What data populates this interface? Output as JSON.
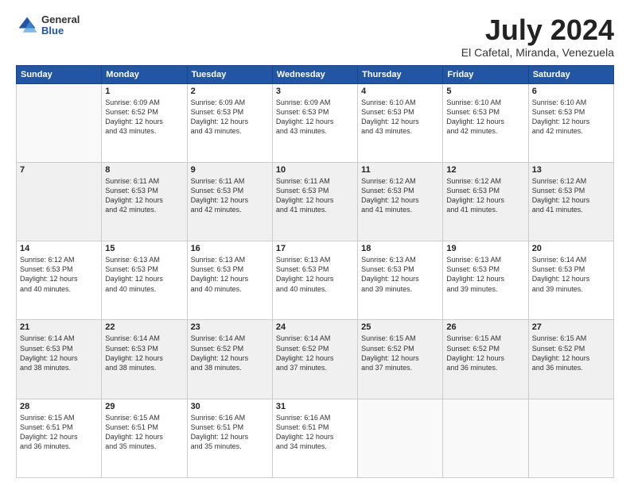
{
  "logo": {
    "general": "General",
    "blue": "Blue"
  },
  "title": {
    "month_year": "July 2024",
    "location": "El Cafetal, Miranda, Venezuela"
  },
  "days_of_week": [
    "Sunday",
    "Monday",
    "Tuesday",
    "Wednesday",
    "Thursday",
    "Friday",
    "Saturday"
  ],
  "weeks": [
    [
      {
        "day": "",
        "lines": []
      },
      {
        "day": "1",
        "lines": [
          "Sunrise: 6:09 AM",
          "Sunset: 6:52 PM",
          "Daylight: 12 hours",
          "and 43 minutes."
        ]
      },
      {
        "day": "2",
        "lines": [
          "Sunrise: 6:09 AM",
          "Sunset: 6:53 PM",
          "Daylight: 12 hours",
          "and 43 minutes."
        ]
      },
      {
        "day": "3",
        "lines": [
          "Sunrise: 6:09 AM",
          "Sunset: 6:53 PM",
          "Daylight: 12 hours",
          "and 43 minutes."
        ]
      },
      {
        "day": "4",
        "lines": [
          "Sunrise: 6:10 AM",
          "Sunset: 6:53 PM",
          "Daylight: 12 hours",
          "and 43 minutes."
        ]
      },
      {
        "day": "5",
        "lines": [
          "Sunrise: 6:10 AM",
          "Sunset: 6:53 PM",
          "Daylight: 12 hours",
          "and 42 minutes."
        ]
      },
      {
        "day": "6",
        "lines": [
          "Sunrise: 6:10 AM",
          "Sunset: 6:53 PM",
          "Daylight: 12 hours",
          "and 42 minutes."
        ]
      }
    ],
    [
      {
        "day": "7",
        "lines": []
      },
      {
        "day": "8",
        "lines": [
          "Sunrise: 6:11 AM",
          "Sunset: 6:53 PM",
          "Daylight: 12 hours",
          "and 42 minutes."
        ]
      },
      {
        "day": "9",
        "lines": [
          "Sunrise: 6:11 AM",
          "Sunset: 6:53 PM",
          "Daylight: 12 hours",
          "and 42 minutes."
        ]
      },
      {
        "day": "10",
        "lines": [
          "Sunrise: 6:11 AM",
          "Sunset: 6:53 PM",
          "Daylight: 12 hours",
          "and 41 minutes."
        ]
      },
      {
        "day": "11",
        "lines": [
          "Sunrise: 6:12 AM",
          "Sunset: 6:53 PM",
          "Daylight: 12 hours",
          "and 41 minutes."
        ]
      },
      {
        "day": "12",
        "lines": [
          "Sunrise: 6:12 AM",
          "Sunset: 6:53 PM",
          "Daylight: 12 hours",
          "and 41 minutes."
        ]
      },
      {
        "day": "13",
        "lines": [
          "Sunrise: 6:12 AM",
          "Sunset: 6:53 PM",
          "Daylight: 12 hours",
          "and 41 minutes."
        ]
      }
    ],
    [
      {
        "day": "14",
        "lines": [
          "Sunrise: 6:12 AM",
          "Sunset: 6:53 PM",
          "Daylight: 12 hours",
          "and 40 minutes."
        ]
      },
      {
        "day": "15",
        "lines": [
          "Sunrise: 6:13 AM",
          "Sunset: 6:53 PM",
          "Daylight: 12 hours",
          "and 40 minutes."
        ]
      },
      {
        "day": "16",
        "lines": [
          "Sunrise: 6:13 AM",
          "Sunset: 6:53 PM",
          "Daylight: 12 hours",
          "and 40 minutes."
        ]
      },
      {
        "day": "17",
        "lines": [
          "Sunrise: 6:13 AM",
          "Sunset: 6:53 PM",
          "Daylight: 12 hours",
          "and 40 minutes."
        ]
      },
      {
        "day": "18",
        "lines": [
          "Sunrise: 6:13 AM",
          "Sunset: 6:53 PM",
          "Daylight: 12 hours",
          "and 39 minutes."
        ]
      },
      {
        "day": "19",
        "lines": [
          "Sunrise: 6:13 AM",
          "Sunset: 6:53 PM",
          "Daylight: 12 hours",
          "and 39 minutes."
        ]
      },
      {
        "day": "20",
        "lines": [
          "Sunrise: 6:14 AM",
          "Sunset: 6:53 PM",
          "Daylight: 12 hours",
          "and 39 minutes."
        ]
      }
    ],
    [
      {
        "day": "21",
        "lines": [
          "Sunrise: 6:14 AM",
          "Sunset: 6:53 PM",
          "Daylight: 12 hours",
          "and 38 minutes."
        ]
      },
      {
        "day": "22",
        "lines": [
          "Sunrise: 6:14 AM",
          "Sunset: 6:53 PM",
          "Daylight: 12 hours",
          "and 38 minutes."
        ]
      },
      {
        "day": "23",
        "lines": [
          "Sunrise: 6:14 AM",
          "Sunset: 6:52 PM",
          "Daylight: 12 hours",
          "and 38 minutes."
        ]
      },
      {
        "day": "24",
        "lines": [
          "Sunrise: 6:14 AM",
          "Sunset: 6:52 PM",
          "Daylight: 12 hours",
          "and 37 minutes."
        ]
      },
      {
        "day": "25",
        "lines": [
          "Sunrise: 6:15 AM",
          "Sunset: 6:52 PM",
          "Daylight: 12 hours",
          "and 37 minutes."
        ]
      },
      {
        "day": "26",
        "lines": [
          "Sunrise: 6:15 AM",
          "Sunset: 6:52 PM",
          "Daylight: 12 hours",
          "and 36 minutes."
        ]
      },
      {
        "day": "27",
        "lines": [
          "Sunrise: 6:15 AM",
          "Sunset: 6:52 PM",
          "Daylight: 12 hours",
          "and 36 minutes."
        ]
      }
    ],
    [
      {
        "day": "28",
        "lines": [
          "Sunrise: 6:15 AM",
          "Sunset: 6:51 PM",
          "Daylight: 12 hours",
          "and 36 minutes."
        ]
      },
      {
        "day": "29",
        "lines": [
          "Sunrise: 6:15 AM",
          "Sunset: 6:51 PM",
          "Daylight: 12 hours",
          "and 35 minutes."
        ]
      },
      {
        "day": "30",
        "lines": [
          "Sunrise: 6:16 AM",
          "Sunset: 6:51 PM",
          "Daylight: 12 hours",
          "and 35 minutes."
        ]
      },
      {
        "day": "31",
        "lines": [
          "Sunrise: 6:16 AM",
          "Sunset: 6:51 PM",
          "Daylight: 12 hours",
          "and 34 minutes."
        ]
      },
      {
        "day": "",
        "lines": []
      },
      {
        "day": "",
        "lines": []
      },
      {
        "day": "",
        "lines": []
      }
    ]
  ]
}
